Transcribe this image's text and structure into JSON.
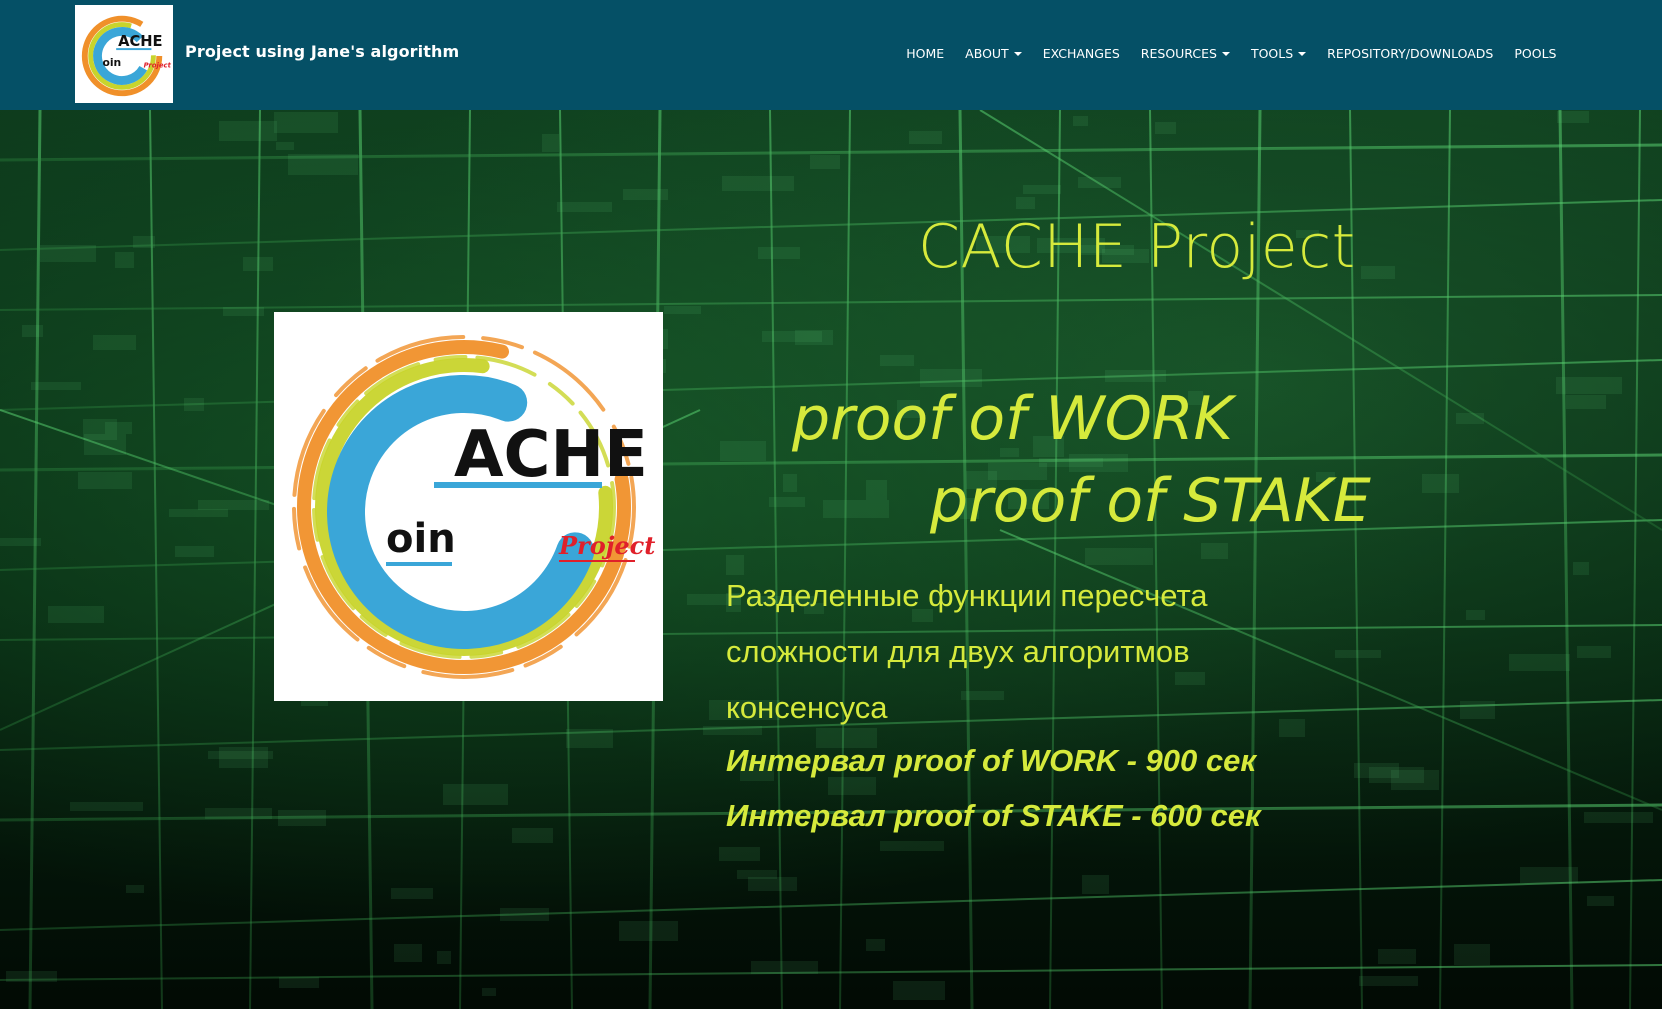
{
  "brand": {
    "title": "Project using Jane's algorithm",
    "logo_text": {
      "main": "ACHE",
      "sub": "oin",
      "tag": "Project"
    }
  },
  "nav": {
    "items": [
      {
        "label": "HOME",
        "dropdown": false
      },
      {
        "label": "ABOUT",
        "dropdown": true
      },
      {
        "label": "EXCHANGES",
        "dropdown": false
      },
      {
        "label": "RESOURCES",
        "dropdown": true
      },
      {
        "label": "TOOLS",
        "dropdown": true
      },
      {
        "label": "REPOSITORY/DOWNLOADS",
        "dropdown": false
      },
      {
        "label": "POOLS",
        "dropdown": false
      }
    ]
  },
  "hero": {
    "title": "CACHE Project",
    "pow": "proof of WORK",
    "pos": "proof of STAKE",
    "description": "Разделенные функции пересчета сложности для двух алгоритмов консенсуса",
    "interval_pow": "Интервал proof of WORK - 900 сек",
    "interval_pos": "Интервал  proof of STAKE - 600 сек"
  },
  "colors": {
    "navbar": "#055066",
    "accent_text": "#d6ea3c",
    "logo_orange": "#f0902a",
    "logo_yellow": "#c8d42c",
    "logo_blue": "#3aa6d8",
    "logo_red": "#e0202a"
  }
}
